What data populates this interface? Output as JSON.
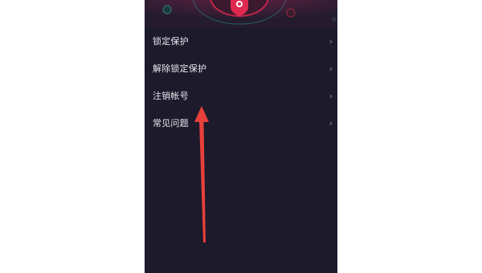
{
  "menu": {
    "items": [
      {
        "label": "锁定保护",
        "chevron": "›"
      },
      {
        "label": "解除锁定保护",
        "chevron": "›"
      },
      {
        "label": "注销帐号",
        "chevron": "›"
      },
      {
        "label": "常见问题",
        "chevron": "›"
      }
    ]
  },
  "banner": {
    "icon": "shield-icon"
  },
  "annotation": {
    "color": "#e8403a",
    "points_to": "注销帐号"
  },
  "colors": {
    "background": "#1c1a2b",
    "accent_red": "#e0294f",
    "accent_teal": "#2fd3c9",
    "text": "#e8e8ee"
  }
}
